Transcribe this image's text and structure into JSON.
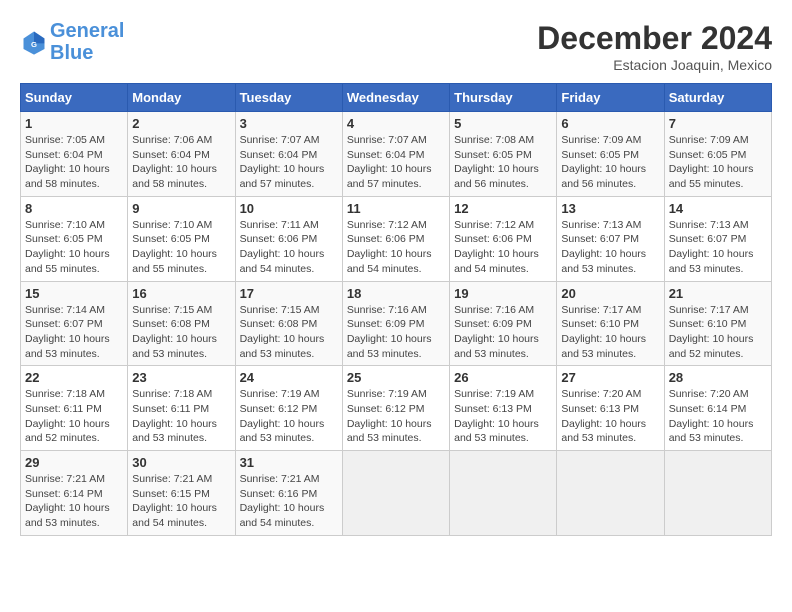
{
  "logo": {
    "line1": "General",
    "line2": "Blue"
  },
  "title": "December 2024",
  "subtitle": "Estacion Joaquin, Mexico",
  "days_of_week": [
    "Sunday",
    "Monday",
    "Tuesday",
    "Wednesday",
    "Thursday",
    "Friday",
    "Saturday"
  ],
  "weeks": [
    [
      {
        "day": "1",
        "sunrise": "7:05 AM",
        "sunset": "6:04 PM",
        "daylight": "10 hours and 58 minutes."
      },
      {
        "day": "2",
        "sunrise": "7:06 AM",
        "sunset": "6:04 PM",
        "daylight": "10 hours and 58 minutes."
      },
      {
        "day": "3",
        "sunrise": "7:07 AM",
        "sunset": "6:04 PM",
        "daylight": "10 hours and 57 minutes."
      },
      {
        "day": "4",
        "sunrise": "7:07 AM",
        "sunset": "6:04 PM",
        "daylight": "10 hours and 57 minutes."
      },
      {
        "day": "5",
        "sunrise": "7:08 AM",
        "sunset": "6:05 PM",
        "daylight": "10 hours and 56 minutes."
      },
      {
        "day": "6",
        "sunrise": "7:09 AM",
        "sunset": "6:05 PM",
        "daylight": "10 hours and 56 minutes."
      },
      {
        "day": "7",
        "sunrise": "7:09 AM",
        "sunset": "6:05 PM",
        "daylight": "10 hours and 55 minutes."
      }
    ],
    [
      {
        "day": "8",
        "sunrise": "7:10 AM",
        "sunset": "6:05 PM",
        "daylight": "10 hours and 55 minutes."
      },
      {
        "day": "9",
        "sunrise": "7:10 AM",
        "sunset": "6:05 PM",
        "daylight": "10 hours and 55 minutes."
      },
      {
        "day": "10",
        "sunrise": "7:11 AM",
        "sunset": "6:06 PM",
        "daylight": "10 hours and 54 minutes."
      },
      {
        "day": "11",
        "sunrise": "7:12 AM",
        "sunset": "6:06 PM",
        "daylight": "10 hours and 54 minutes."
      },
      {
        "day": "12",
        "sunrise": "7:12 AM",
        "sunset": "6:06 PM",
        "daylight": "10 hours and 54 minutes."
      },
      {
        "day": "13",
        "sunrise": "7:13 AM",
        "sunset": "6:07 PM",
        "daylight": "10 hours and 53 minutes."
      },
      {
        "day": "14",
        "sunrise": "7:13 AM",
        "sunset": "6:07 PM",
        "daylight": "10 hours and 53 minutes."
      }
    ],
    [
      {
        "day": "15",
        "sunrise": "7:14 AM",
        "sunset": "6:07 PM",
        "daylight": "10 hours and 53 minutes."
      },
      {
        "day": "16",
        "sunrise": "7:15 AM",
        "sunset": "6:08 PM",
        "daylight": "10 hours and 53 minutes."
      },
      {
        "day": "17",
        "sunrise": "7:15 AM",
        "sunset": "6:08 PM",
        "daylight": "10 hours and 53 minutes."
      },
      {
        "day": "18",
        "sunrise": "7:16 AM",
        "sunset": "6:09 PM",
        "daylight": "10 hours and 53 minutes."
      },
      {
        "day": "19",
        "sunrise": "7:16 AM",
        "sunset": "6:09 PM",
        "daylight": "10 hours and 53 minutes."
      },
      {
        "day": "20",
        "sunrise": "7:17 AM",
        "sunset": "6:10 PM",
        "daylight": "10 hours and 53 minutes."
      },
      {
        "day": "21",
        "sunrise": "7:17 AM",
        "sunset": "6:10 PM",
        "daylight": "10 hours and 52 minutes."
      }
    ],
    [
      {
        "day": "22",
        "sunrise": "7:18 AM",
        "sunset": "6:11 PM",
        "daylight": "10 hours and 52 minutes."
      },
      {
        "day": "23",
        "sunrise": "7:18 AM",
        "sunset": "6:11 PM",
        "daylight": "10 hours and 53 minutes."
      },
      {
        "day": "24",
        "sunrise": "7:19 AM",
        "sunset": "6:12 PM",
        "daylight": "10 hours and 53 minutes."
      },
      {
        "day": "25",
        "sunrise": "7:19 AM",
        "sunset": "6:12 PM",
        "daylight": "10 hours and 53 minutes."
      },
      {
        "day": "26",
        "sunrise": "7:19 AM",
        "sunset": "6:13 PM",
        "daylight": "10 hours and 53 minutes."
      },
      {
        "day": "27",
        "sunrise": "7:20 AM",
        "sunset": "6:13 PM",
        "daylight": "10 hours and 53 minutes."
      },
      {
        "day": "28",
        "sunrise": "7:20 AM",
        "sunset": "6:14 PM",
        "daylight": "10 hours and 53 minutes."
      }
    ],
    [
      {
        "day": "29",
        "sunrise": "7:21 AM",
        "sunset": "6:14 PM",
        "daylight": "10 hours and 53 minutes."
      },
      {
        "day": "30",
        "sunrise": "7:21 AM",
        "sunset": "6:15 PM",
        "daylight": "10 hours and 54 minutes."
      },
      {
        "day": "31",
        "sunrise": "7:21 AM",
        "sunset": "6:16 PM",
        "daylight": "10 hours and 54 minutes."
      },
      null,
      null,
      null,
      null
    ]
  ]
}
